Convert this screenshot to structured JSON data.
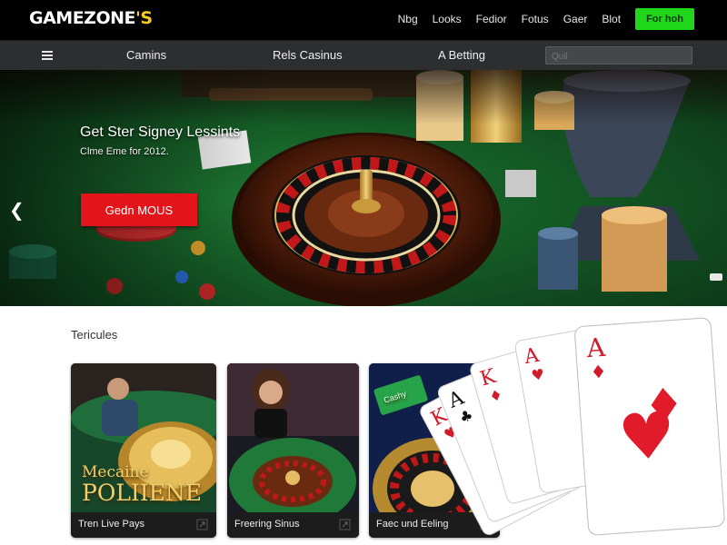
{
  "header": {
    "logo_main": "GAMEZONE",
    "logo_accent": "'S",
    "nav": [
      "Nbg",
      "Looks",
      "Fedior",
      "Fotus",
      "Gaer",
      "Blot"
    ],
    "join_button": "For hoh"
  },
  "subnav": {
    "menu_icon": "hamburger-icon",
    "items": [
      "Camins",
      "Rels Casinus",
      "A Betting"
    ],
    "search_placeholder": "Quil"
  },
  "hero": {
    "title": "Get Ster Signey Lessints",
    "subtitle": "Clme Eme for 2012.",
    "cta": "Gedn MOUS",
    "prev_icon": "chevron-left-icon",
    "colors": {
      "felt": "#1a6b2c",
      "cta": "#e3151a"
    }
  },
  "section": {
    "title": "Tericules",
    "cards": [
      {
        "label": "Tren Live Pays",
        "art_text_top": "Mecaine",
        "art_text_bottom": "POLIIENE"
      },
      {
        "label": "Freering Sinus"
      },
      {
        "label": "Faec und Eeling",
        "sign_text": "Cashy"
      }
    ]
  },
  "playing_cards": [
    "K",
    "A",
    "K",
    "A",
    "A"
  ]
}
